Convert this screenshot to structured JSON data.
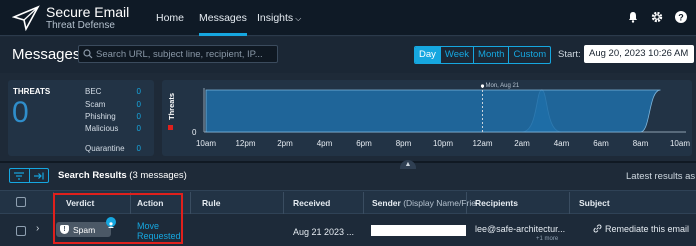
{
  "app": {
    "title": "Secure Email",
    "subtitle": "Threat Defense"
  },
  "nav": {
    "items": [
      "Home",
      "Messages",
      "Insights"
    ],
    "active": "Messages",
    "right_icons": [
      "bell-icon",
      "gear-icon",
      "help-icon"
    ]
  },
  "header": {
    "title": "Messages",
    "search_placeholder": "Search URL, subject line, recipient, IP...",
    "range_options": [
      "Day",
      "Week",
      "Month",
      "Custom"
    ],
    "range_selected": "Day",
    "start_label": "Start:",
    "start_value": "Aug 20, 2023 10:26 AM"
  },
  "threats": {
    "title": "THREATS",
    "total": "0",
    "rows": [
      {
        "label": "BEC",
        "value": "0"
      },
      {
        "label": "Scam",
        "value": "0"
      },
      {
        "label": "Phishing",
        "value": "0"
      },
      {
        "label": "Malicious",
        "value": "0"
      },
      {
        "label": "Quarantine",
        "value": "0"
      }
    ]
  },
  "chart_data": {
    "type": "area",
    "ylabel": "Threats",
    "ytick": "0",
    "x": [
      "10am",
      "12pm",
      "2pm",
      "4pm",
      "6pm",
      "8pm",
      "10pm",
      "12am",
      "2am",
      "4am",
      "6am",
      "8am",
      "10am"
    ],
    "marker_label": "Mon, Aug 21",
    "marker_at": "12am",
    "peaks": [
      {
        "start": "2am",
        "end": "4am"
      },
      {
        "start": "8am",
        "end": "10am"
      }
    ],
    "colors": {
      "area": "#1e6fa8",
      "line": "#8fa0b1",
      "legend": "#e0201c"
    }
  },
  "results": {
    "title": "Search Results",
    "count_text": "(3 messages)",
    "latest_text": "Latest results as of",
    "columns": [
      "Verdict",
      "Action",
      "Rule",
      "Received",
      "Sender",
      "(Display Name/Frie",
      "Recipients",
      "Subject"
    ],
    "rows": [
      {
        "verdict": "Spam",
        "action_line1": "Move",
        "action_line2": "Requested",
        "rule": "",
        "received": "Aug 21 2023 ...",
        "recipient": "lee@safe-architectur...",
        "recipient_more": "+1 more",
        "subject_action": "Remediate this email"
      }
    ]
  },
  "colors": {
    "accent": "#16a7e0",
    "highlight": "#e0201c",
    "background": "#1e2a38"
  }
}
